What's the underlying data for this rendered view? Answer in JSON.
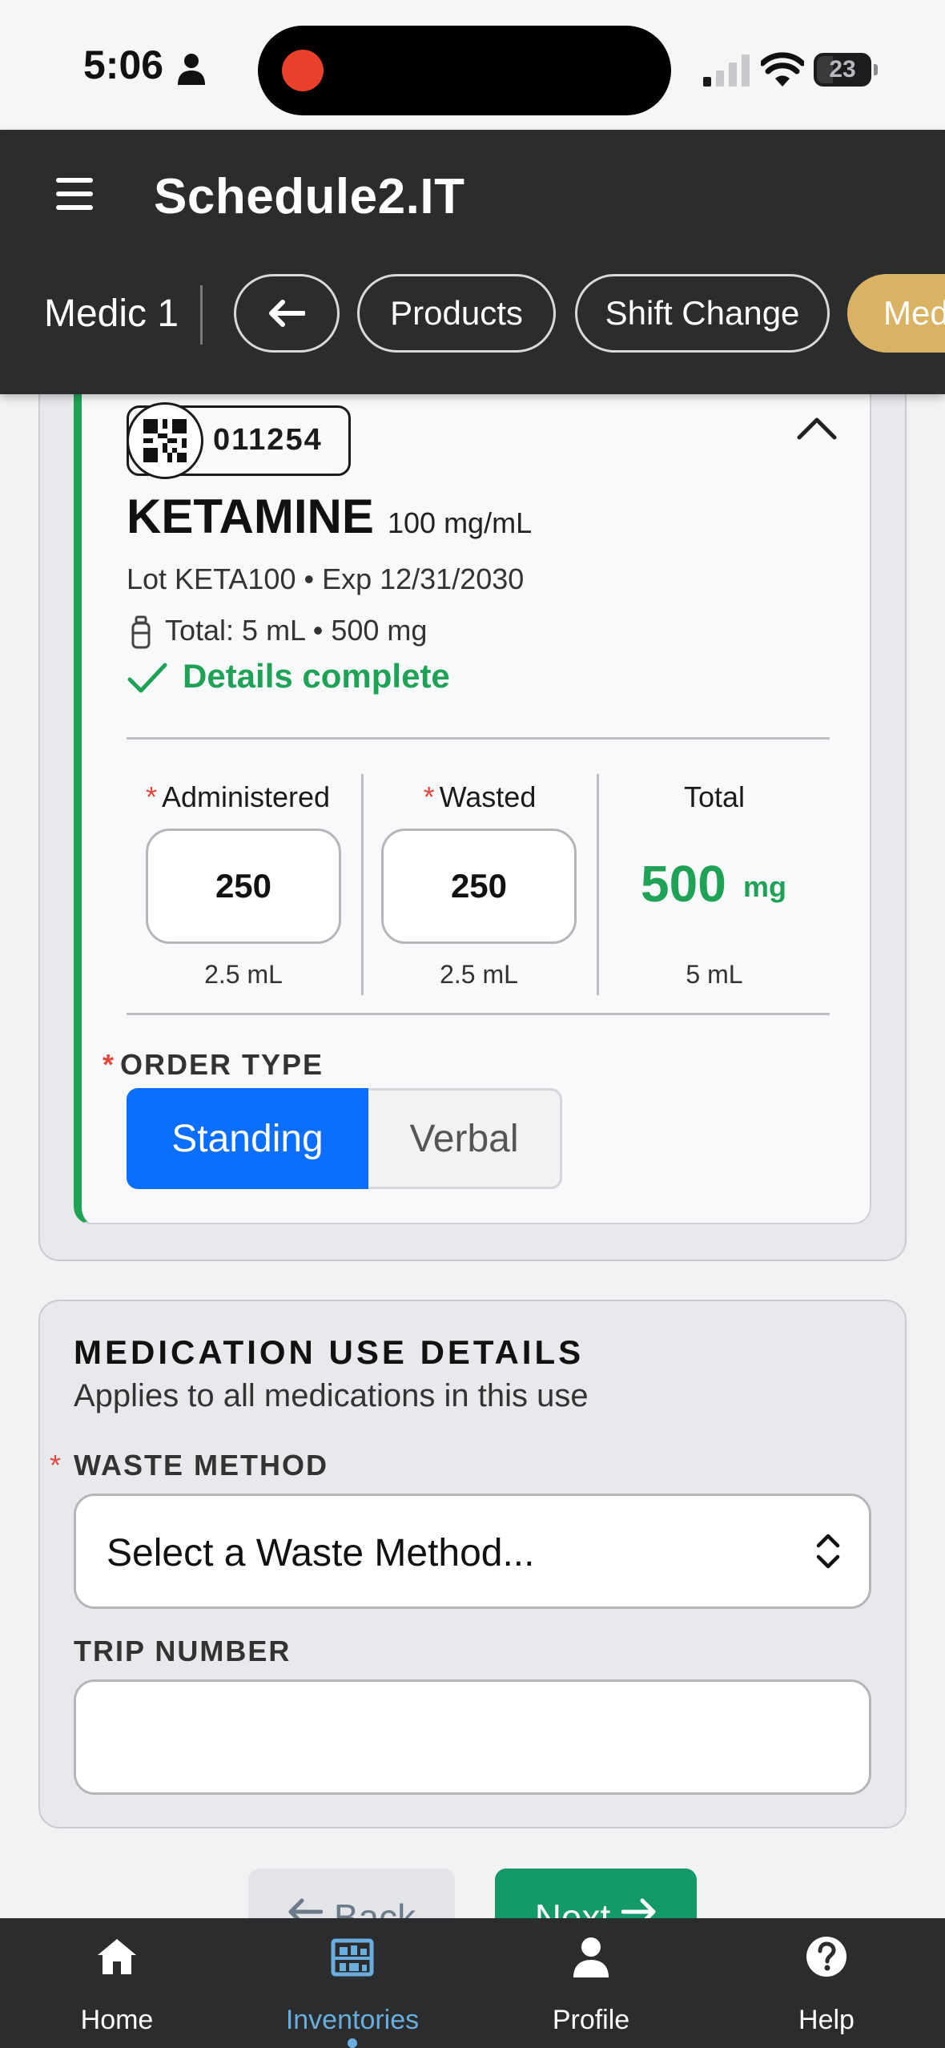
{
  "status_bar": {
    "time": "5:06",
    "battery": "23",
    "icons": [
      "person-icon",
      "signal-icon",
      "wifi-icon",
      "battery-icon"
    ]
  },
  "header": {
    "app_title": "Schedule2.IT",
    "unit": "Medic 1",
    "nav_pills": {
      "back": "←",
      "products": "Products",
      "shift_change": "Shift Change",
      "active": "Med"
    },
    "colors": {
      "background": "#2a2c2d",
      "active_pill": "#d9b264"
    }
  },
  "medication": {
    "code": "011254",
    "name": "KETAMINE",
    "concentration": "100 mg/mL",
    "lot_line": "Lot KETA100 • Exp 12/31/2030",
    "total_line": "Total: 5 mL • 500 mg",
    "status": "Details complete",
    "columns": {
      "administered": {
        "label": "Administered",
        "value": "250",
        "volume": "2.5 mL"
      },
      "wasted": {
        "label": "Wasted",
        "value": "250",
        "volume": "2.5 mL"
      },
      "total": {
        "label": "Total",
        "value": "500",
        "unit": "mg",
        "volume": "5 mL"
      }
    },
    "required_marker": "*",
    "order_type": {
      "label": "ORDER TYPE",
      "options": [
        "Standing",
        "Verbal"
      ],
      "selected": "Standing"
    },
    "colors": {
      "complete": "#20a256",
      "selected": "#0b6efd",
      "required": "#e0483c"
    }
  },
  "use_details": {
    "title": "MEDICATION USE DETAILS",
    "subtitle": "Applies to all medications in this use",
    "waste_method": {
      "label": "WASTE METHOD",
      "placeholder": "Select a Waste Method..."
    },
    "trip_number": {
      "label": "TRIP NUMBER",
      "value": ""
    }
  },
  "actions": {
    "back": "Back",
    "next": "Next"
  },
  "bottom_nav": {
    "items": [
      {
        "label": "Home",
        "icon": "home-icon"
      },
      {
        "label": "Inventories",
        "icon": "inventory-icon",
        "active": true
      },
      {
        "label": "Profile",
        "icon": "profile-icon"
      },
      {
        "label": "Help",
        "icon": "help-icon"
      }
    ]
  }
}
